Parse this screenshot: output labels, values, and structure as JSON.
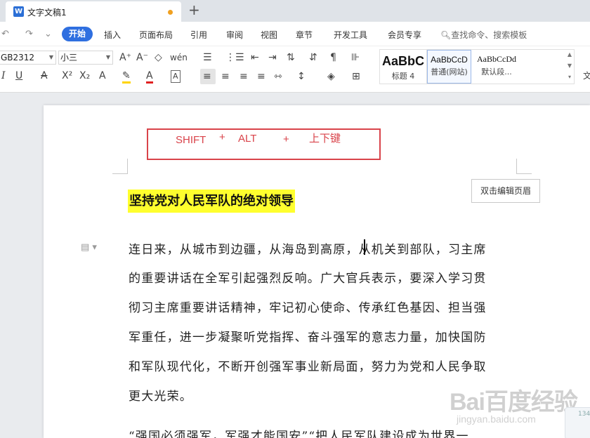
{
  "tab": {
    "title": "文字文稿1",
    "icon_letter": "W",
    "new_tab_symbol": "+"
  },
  "menu": {
    "quick_access": [
      "↶",
      "↷",
      "⌄"
    ],
    "active": "开始",
    "items": [
      "插入",
      "页面布局",
      "引用",
      "审阅",
      "视图",
      "章节",
      "开发工具",
      "会员专享"
    ],
    "search_label": "查找命令、搜索模板"
  },
  "toolbar": {
    "font_name": "GB2312",
    "font_size": "小三",
    "style_gallery": [
      {
        "sample": "AaBbC",
        "name": "标题 4"
      },
      {
        "sample": "AaBbCcD",
        "name": "普通(网站)"
      },
      {
        "sample": "AaBbCcDd",
        "name": "默认段..."
      }
    ],
    "icons": {
      "grow_font": "A⁺",
      "shrink_font": "A⁻",
      "clear_format": "◇",
      "pinyin": "wén",
      "italic": "I",
      "underline": "U",
      "strike": "A",
      "superscript": "X²",
      "subscript": "X₂",
      "text_effect": "A",
      "highlight": "✎",
      "font_color": "A",
      "char_border": "A",
      "bullets": "☰",
      "numbering": "⋮☰",
      "outdent": "⇤",
      "indent": "⇥",
      "chinese_layout": "⇅",
      "sort": "⇵",
      "show_marks": "¶",
      "align_left": "≡",
      "align_center": "≡",
      "align_right": "≡",
      "justify": "≡",
      "distribute": "⇿",
      "line_spacing": "↕",
      "shading": "◈",
      "borders": "⊞",
      "text_direction": "文"
    },
    "accent_color": "#2f6fe0",
    "highlight_color": "#ffd400",
    "font_color": "#e02020"
  },
  "document": {
    "annotation": {
      "shift": "SHIFT",
      "plus1": "+",
      "alt": "ALT",
      "plus2": "+",
      "arrows": "上下键"
    },
    "annotation_color": "#d9434a",
    "header_button": "双击编辑页眉",
    "heading": "坚持党对人民军队的绝对领导",
    "paragraph_lines": [
      "连日来，从城市到边疆，从海岛到高原，从机关到部队，习主席",
      "的重要讲话在全军引起强烈反响。广大官兵表示，要深入学习贯",
      "彻习主席重要讲话精神，牢记初心使命、传承红色基因、担当强",
      "军重任，进一步凝聚听党指挥、奋斗强军的意志力量，加快国防",
      "和军队现代化，不断开创强军事业新局面，努力为党和人民争取",
      "更大光荣。"
    ],
    "next_paragraph": "“强国必须强军，军强才能国安”“把人民军队建设成为世界一",
    "watermark_main": "Bai百度经验",
    "watermark_sub": "jingyan.baidu.com",
    "float_widget_text": "134"
  }
}
